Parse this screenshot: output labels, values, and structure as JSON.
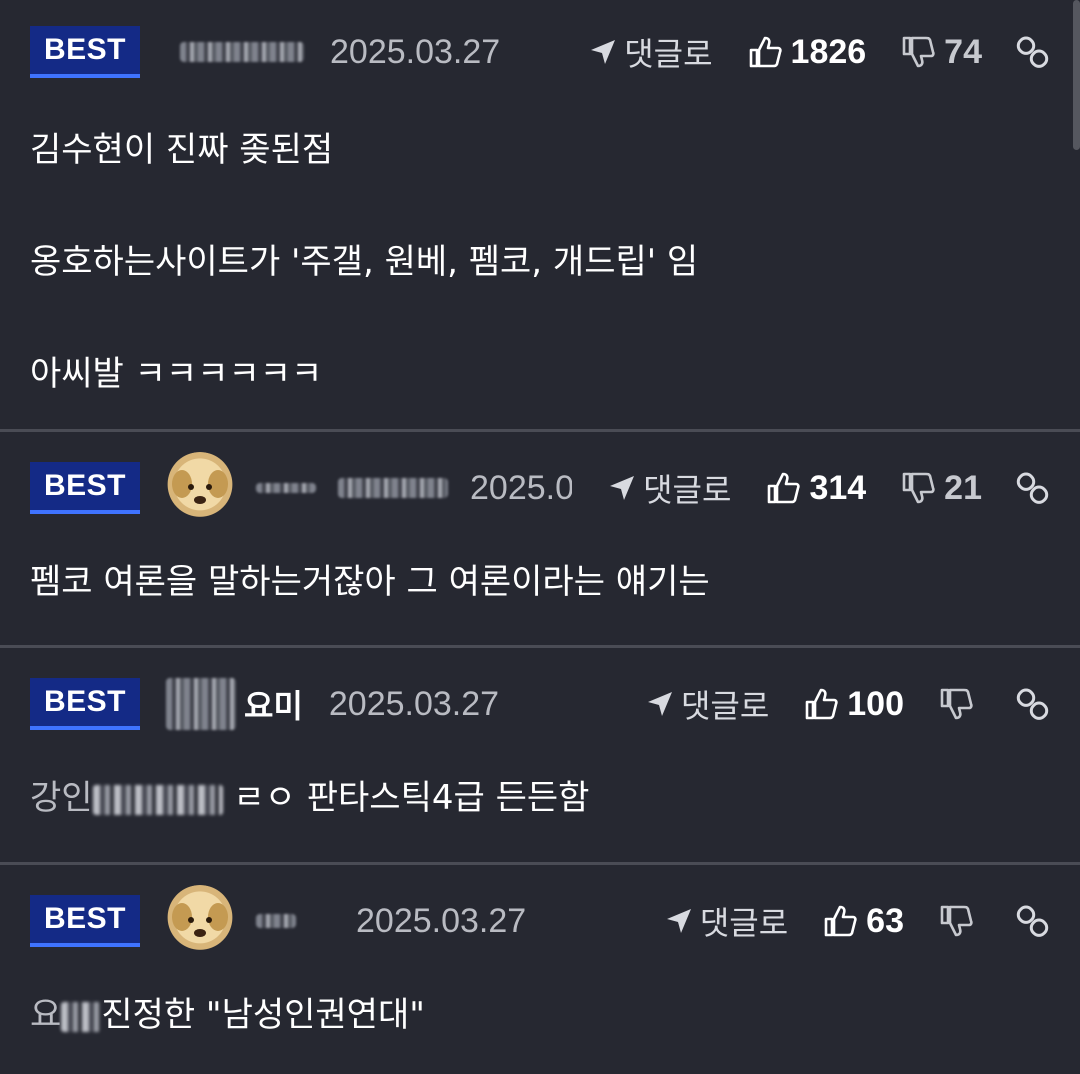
{
  "labels": {
    "best": "BEST",
    "reply": "댓글로"
  },
  "comments": [
    {
      "nickname": "",
      "date": "2025.03.27",
      "likes": "1826",
      "dislikes": "74",
      "lines": [
        "김수현이 진짜 좆된점",
        "옹호하는사이트가 '주갤, 원베, 펨코, 개드립' 임",
        "아씨발 ㅋㅋㅋㅋㅋㅋ"
      ]
    },
    {
      "nickname": "",
      "date": "2025.0",
      "likes": "314",
      "dislikes": "21",
      "lines": [
        "펨코 여론을 말하는거잖아 그 여론이라는 얘기는"
      ]
    },
    {
      "nickname": "요미",
      "date": "2025.03.27",
      "likes": "100",
      "dislikes": "",
      "line_prefix": "강인",
      "line_main": "ㄹㅇ 판타스틱4급 든든함"
    },
    {
      "nickname": "",
      "date": "2025.03.27",
      "likes": "63",
      "dislikes": "",
      "line_prefix": "요",
      "line_main": "진정한 \"남성인권연대\""
    }
  ],
  "icons": {
    "reply": "arrow-reply-icon",
    "like": "thumbs-up-icon",
    "dislike": "thumbs-down-icon",
    "link": "link-icon",
    "avatar": "puppy-avatar"
  },
  "colors": {
    "background": "#262831",
    "badge": "#142a86",
    "badge_underline": "#3f73ff",
    "divider": "#4a4c55",
    "muted_text": "#b9bbc2"
  }
}
